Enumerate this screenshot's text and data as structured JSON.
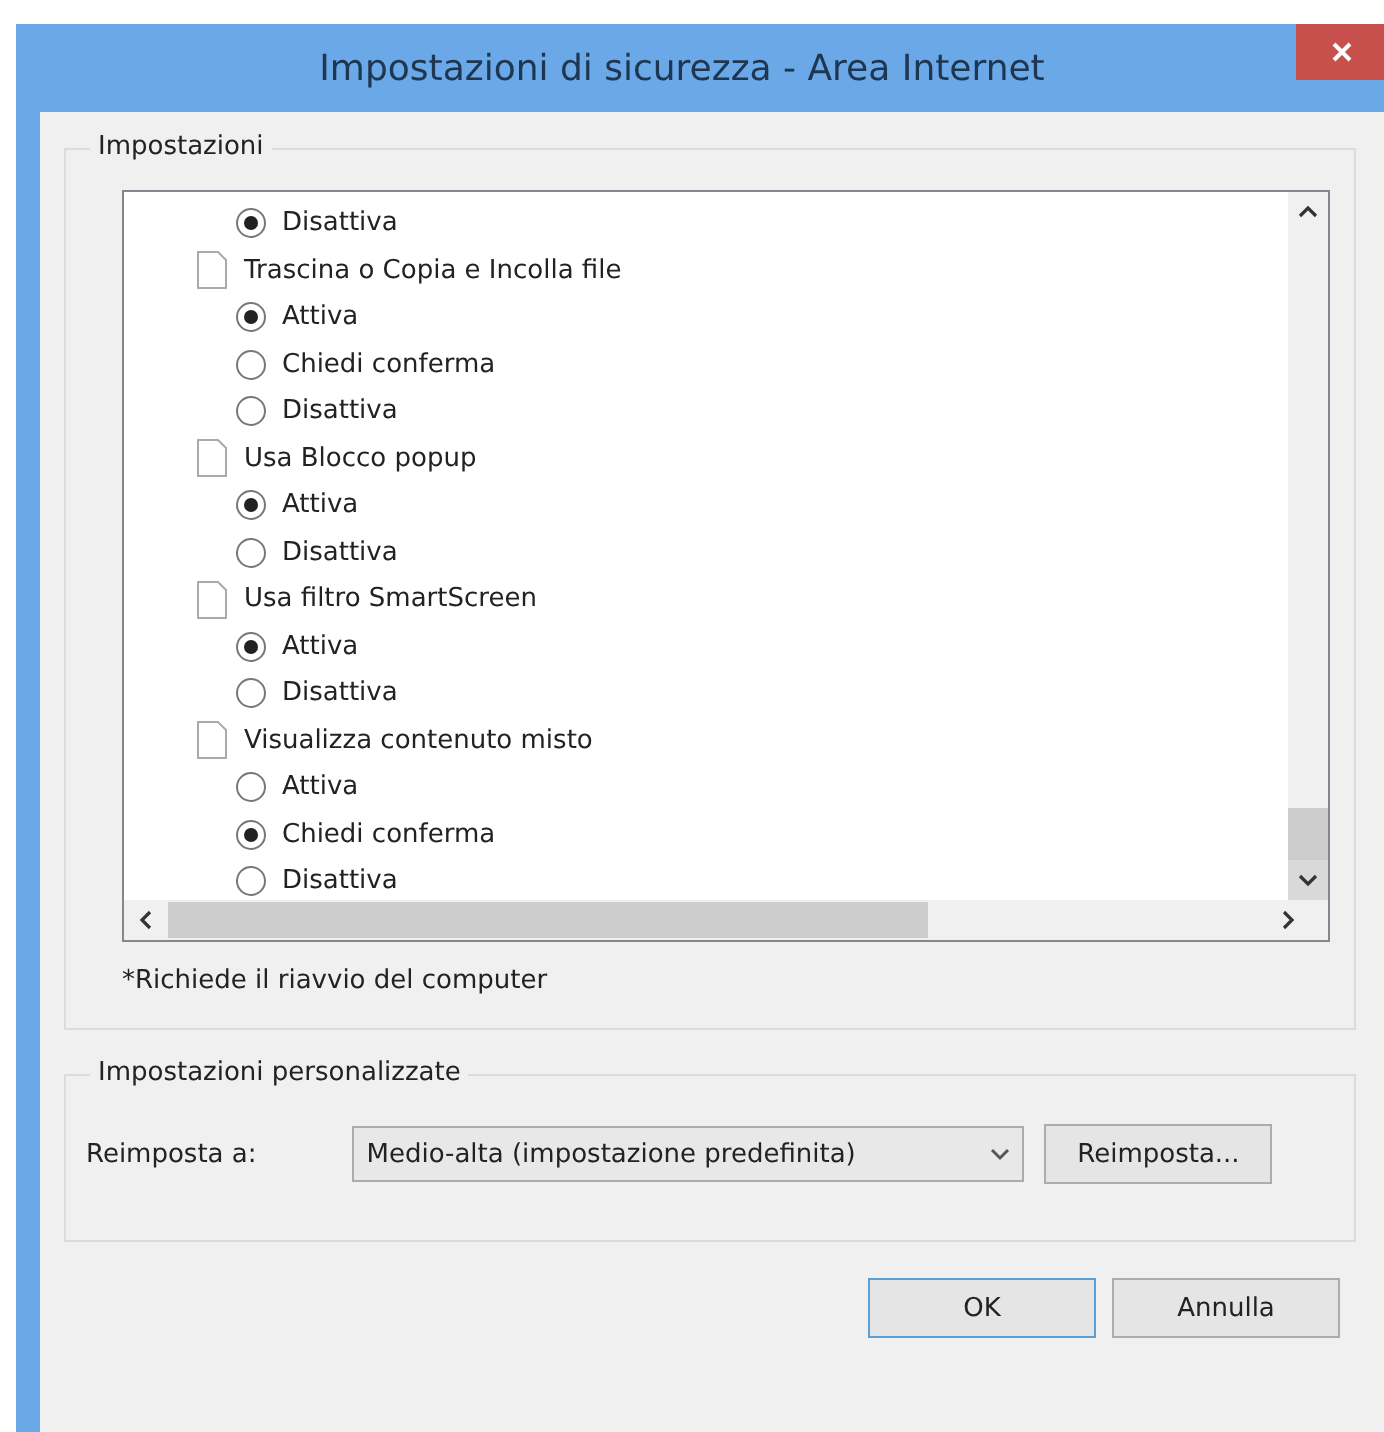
{
  "window": {
    "title": "Impostazioni di sicurezza - Area Internet"
  },
  "settings_group": {
    "label": "Impostazioni",
    "settings": [
      {
        "options": [
          {
            "label": "Disattiva",
            "selected": true
          }
        ]
      },
      {
        "title": "Trascina o Copia e Incolla file",
        "options": [
          {
            "label": "Attiva",
            "selected": true
          },
          {
            "label": "Chiedi conferma",
            "selected": false
          },
          {
            "label": "Disattiva",
            "selected": false
          }
        ]
      },
      {
        "title": "Usa Blocco popup",
        "options": [
          {
            "label": "Attiva",
            "selected": true
          },
          {
            "label": "Disattiva",
            "selected": false
          }
        ]
      },
      {
        "title": "Usa filtro SmartScreen",
        "options": [
          {
            "label": "Attiva",
            "selected": true
          },
          {
            "label": "Disattiva",
            "selected": false
          }
        ]
      },
      {
        "title": "Visualizza contenuto misto",
        "options": [
          {
            "label": "Attiva",
            "selected": false
          },
          {
            "label": "Chiedi conferma",
            "selected": true
          },
          {
            "label": "Disattiva",
            "selected": false
          }
        ]
      }
    ],
    "footnote": "*Richiede il riavvio del computer"
  },
  "custom_group": {
    "label": "Impostazioni personalizzate",
    "reset_label": "Reimposta a:",
    "reset_value": "Medio-alta (impostazione predefinita)",
    "reset_button": "Reimposta..."
  },
  "buttons": [
    "OK",
    "Annulla"
  ]
}
